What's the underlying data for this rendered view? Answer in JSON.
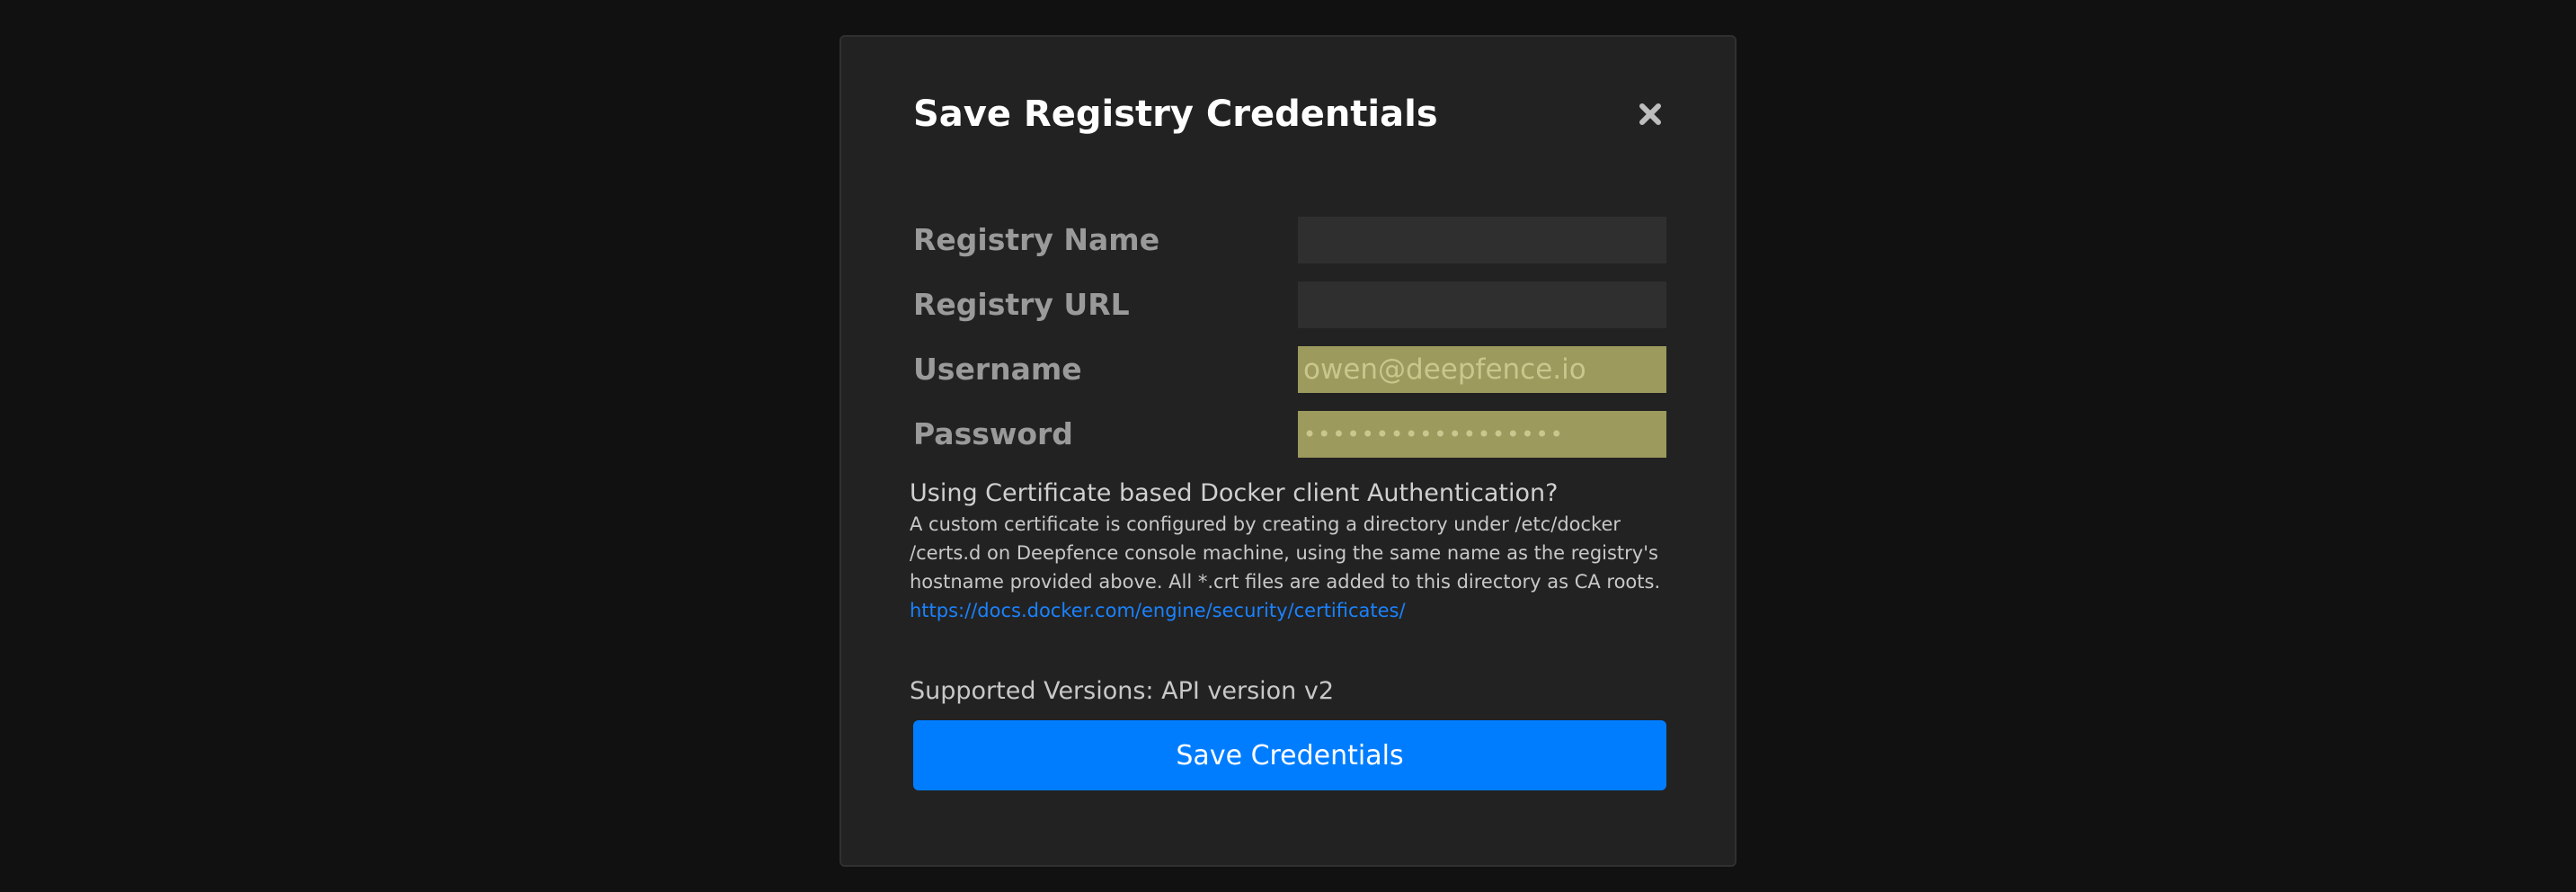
{
  "modal": {
    "title": "Save Registry Credentials",
    "close_icon": "close-icon"
  },
  "form": {
    "fields": [
      {
        "label": "Registry Name",
        "value": "",
        "placeholder": ""
      },
      {
        "label": "Registry URL",
        "value": "",
        "placeholder": ""
      },
      {
        "label": "Username",
        "value": "owen@deepfence.io",
        "placeholder": ""
      },
      {
        "label": "Password",
        "value": "••••••••••••••••••",
        "placeholder": ""
      }
    ]
  },
  "certificate_info": {
    "heading": "Using Certificate based Docker client Authentication?",
    "lines": [
      "A custom certificate is configured by creating a directory under /etc/docker",
      "/certs.d on Deepfence console machine, using the same name as the registry's",
      "hostname provided above. All *.crt files are added to this directory as CA roots."
    ],
    "link_text": "https://docs.docker.com/engine/security/certificates/"
  },
  "supported_versions": "Supported Versions: API version v2",
  "submit_label": "Save Credentials",
  "colors": {
    "accent": "#007dff",
    "link": "#1a82ff",
    "autofill": "#9c9a5c",
    "modal_bg": "#222222",
    "page_bg": "#111111"
  }
}
